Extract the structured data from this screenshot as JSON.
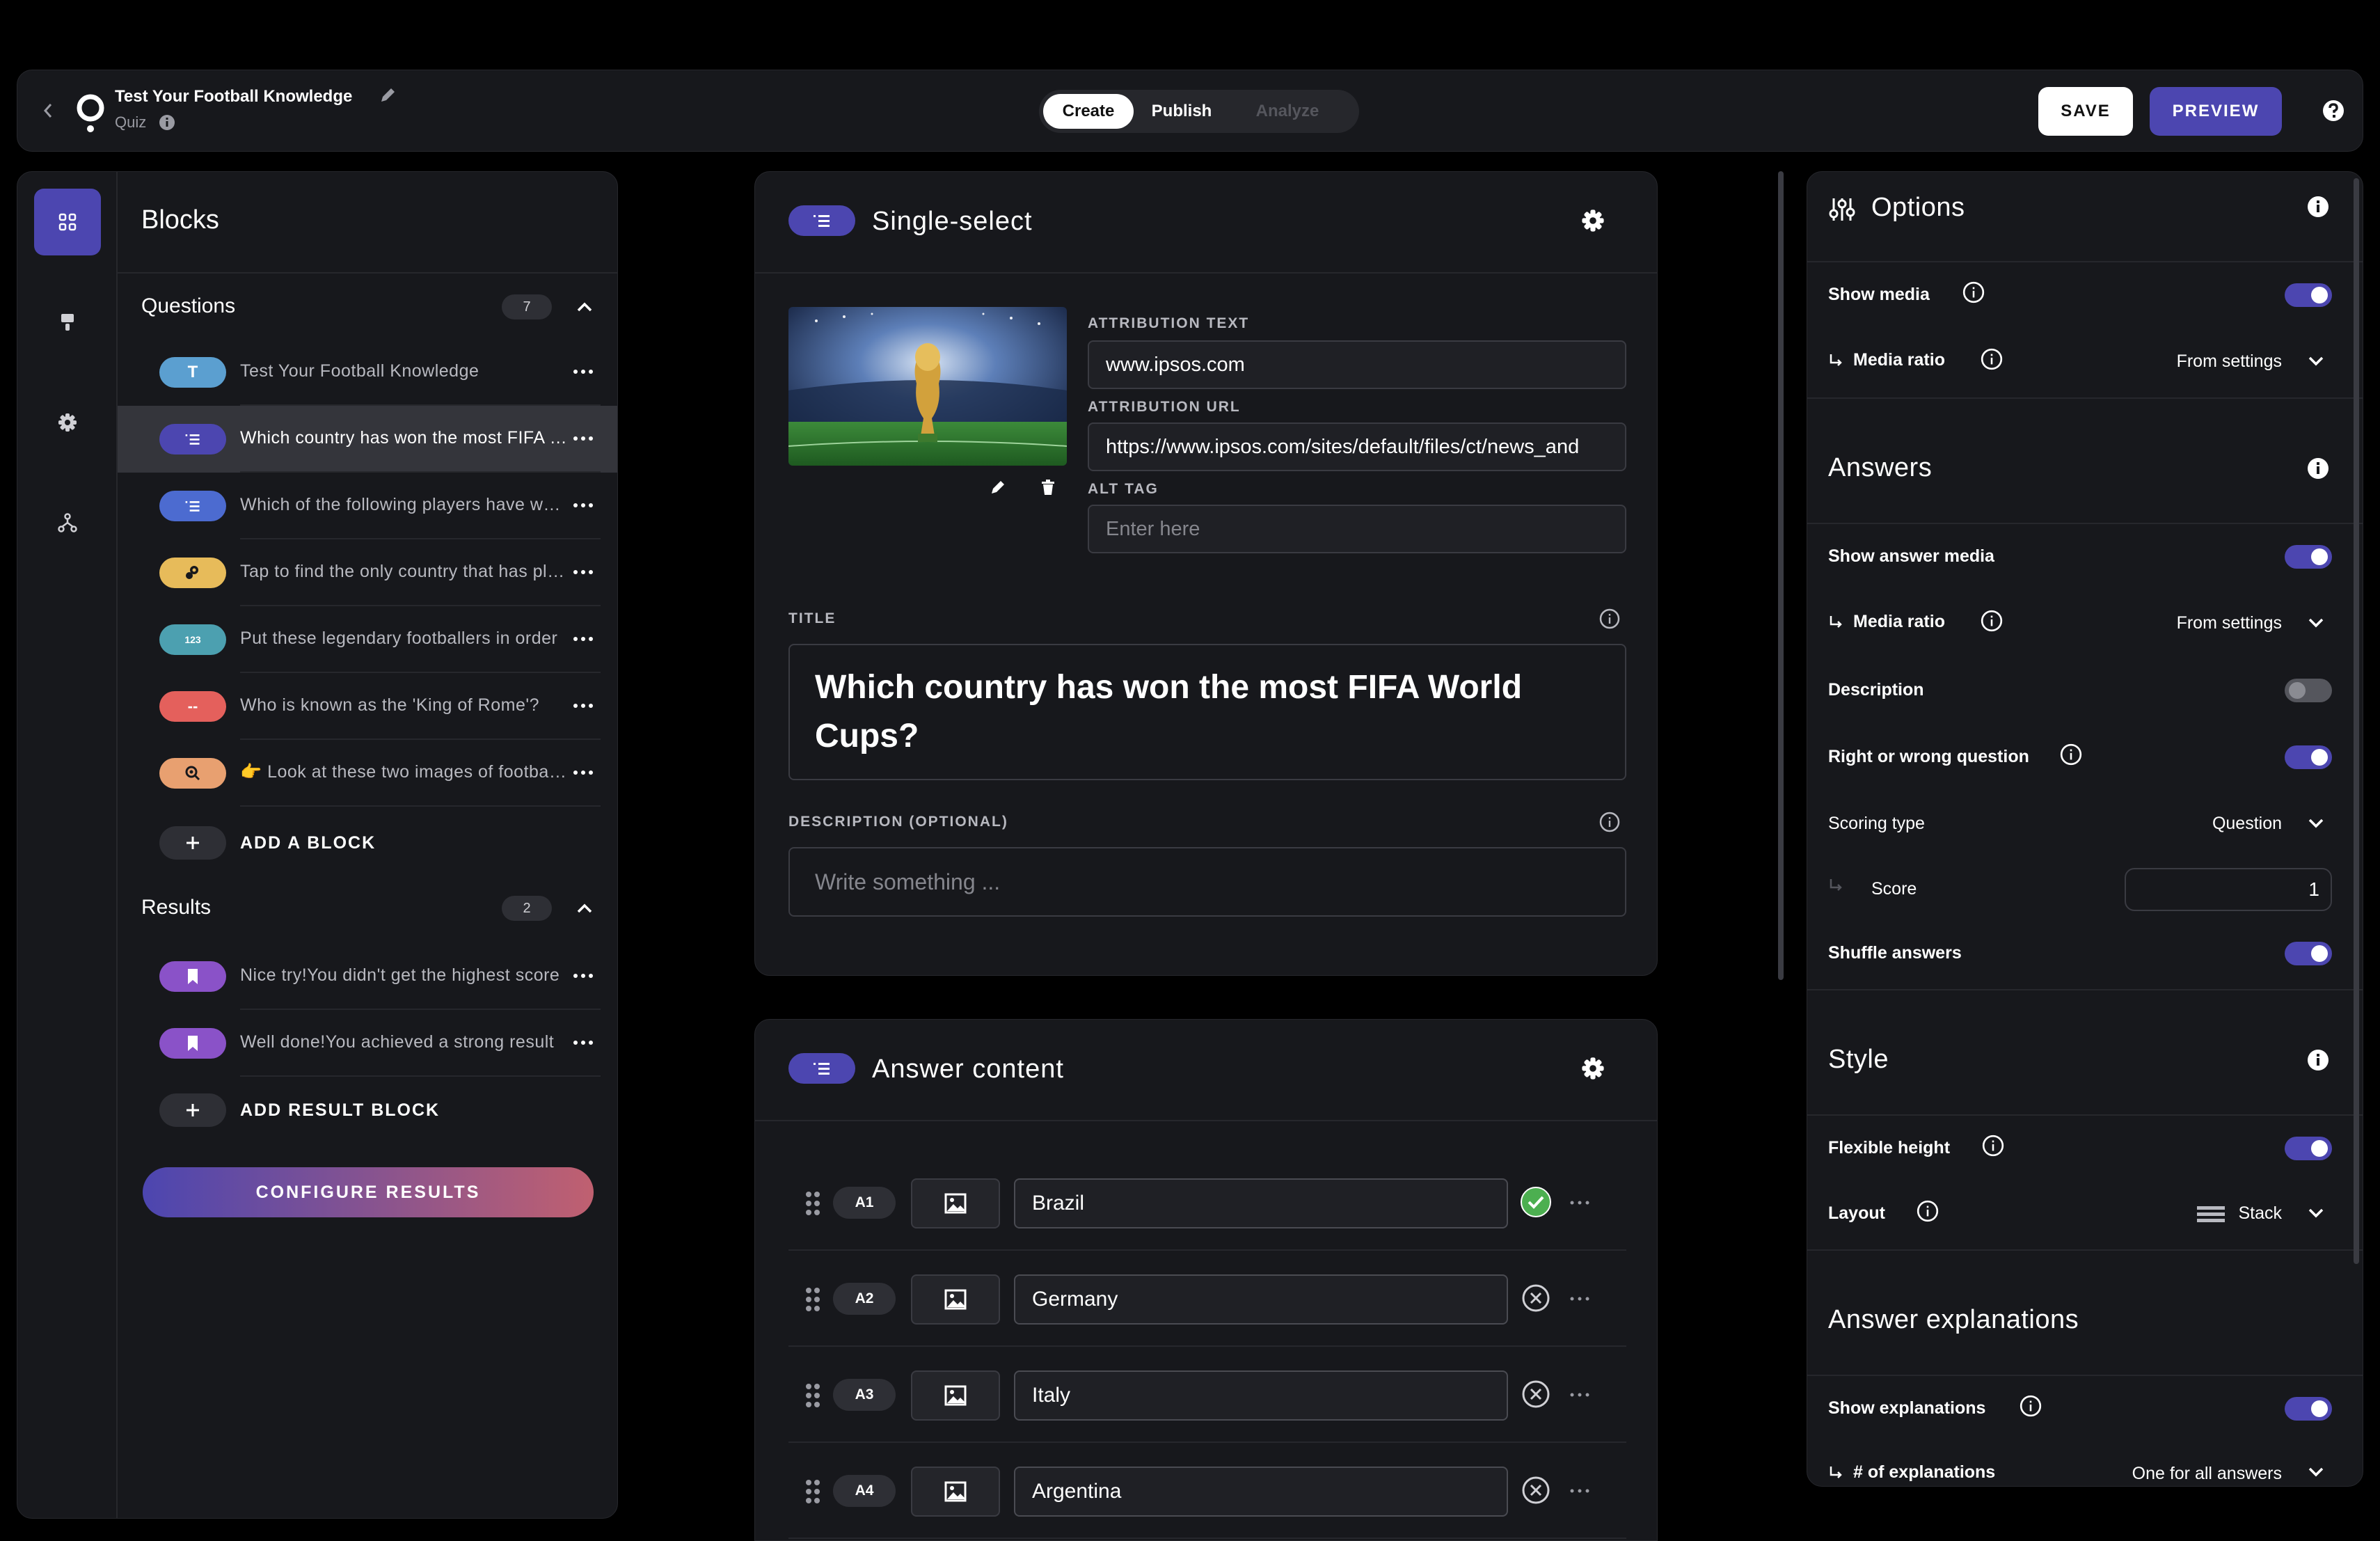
{
  "header": {
    "title": "Test Your Football Knowledge",
    "subtitle": "Quiz",
    "modes": [
      "Create",
      "Publish",
      "Analyze"
    ],
    "save_label": "SAVE",
    "preview_label": "PREVIEW"
  },
  "sidebar": {
    "title": "Blocks",
    "questions_label": "Questions",
    "questions_count": "7",
    "questions": [
      {
        "icon": "T",
        "label": "Test Your Football Knowledge",
        "color": "#5b9fd0"
      },
      {
        "icon": "list",
        "label": "Which country has won the most FIFA World Cups?",
        "color": "#4c46b0"
      },
      {
        "icon": "list",
        "label": "Which of the following players have won the Ballon d'Or?",
        "color": "#4c6bd0"
      },
      {
        "icon": "drag",
        "label": "Tap to find the only country that has played in every World Cup",
        "color": "#e7bb5a"
      },
      {
        "icon": "123",
        "label": "Put these legendary footballers in order",
        "color": "#4ca0b0"
      },
      {
        "icon": "--",
        "label": "Who is known as the 'King of Rome'?",
        "color": "#e4605c"
      },
      {
        "icon": "zoom",
        "label": "👉 Look at these two images of football stadiums",
        "color": "#e8a070"
      }
    ],
    "add_block_label": "ADD A BLOCK",
    "results_label": "Results",
    "results_count": "2",
    "results": [
      {
        "label": "Nice try!You didn't get the highest score",
        "color": "#8a52c8"
      },
      {
        "label": "Well done!You achieved a strong result",
        "color": "#8a52c8"
      }
    ],
    "add_result_label": "ADD RESULT BLOCK",
    "configure_label": "CONFIGURE RESULTS"
  },
  "editor": {
    "block_type": "Single-select",
    "attribution_text_label": "ATTRIBUTION TEXT",
    "attribution_text": "www.ipsos.com",
    "attribution_url_label": "ATTRIBUTION URL",
    "attribution_url": "https://www.ipsos.com/sites/default/files/ct/news_and",
    "alt_tag_label": "ALT TAG",
    "alt_tag_placeholder": "Enter here",
    "title_label": "TITLE",
    "title": "Which country has won the most FIFA World Cups?",
    "description_label": "DESCRIPTION (OPTIONAL)",
    "description_placeholder": "Write something ..."
  },
  "answers": {
    "title": "Answer content",
    "items": [
      {
        "id": "A1",
        "text": "Brazil",
        "correct": true
      },
      {
        "id": "A2",
        "text": "Germany",
        "correct": false
      },
      {
        "id": "A3",
        "text": "Italy",
        "correct": false
      },
      {
        "id": "A4",
        "text": "Argentina",
        "correct": false
      }
    ]
  },
  "options": {
    "title": "Options",
    "show_media": "Show media",
    "media_ratio": "Media ratio",
    "media_ratio_value": "From settings",
    "answers_title": "Answers",
    "show_answer_media": "Show answer media",
    "media_ratio_2": "Media ratio",
    "media_ratio_2_value": "From settings",
    "description": "Description",
    "right_wrong": "Right or wrong question",
    "scoring_type": "Scoring type",
    "scoring_type_value": "Question",
    "score": "Score",
    "score_value": "1",
    "shuffle": "Shuffle answers",
    "style_title": "Style",
    "flexible_height": "Flexible height",
    "layout": "Layout",
    "layout_value": "Stack",
    "explanations_title": "Answer explanations",
    "show_explanations": "Show explanations",
    "num_explanations": "# of explanations",
    "num_explanations_value": "One for all answers"
  },
  "colors": {
    "accent": "#4c46b0",
    "panel": "#17181c",
    "correct": "#4caf50"
  }
}
